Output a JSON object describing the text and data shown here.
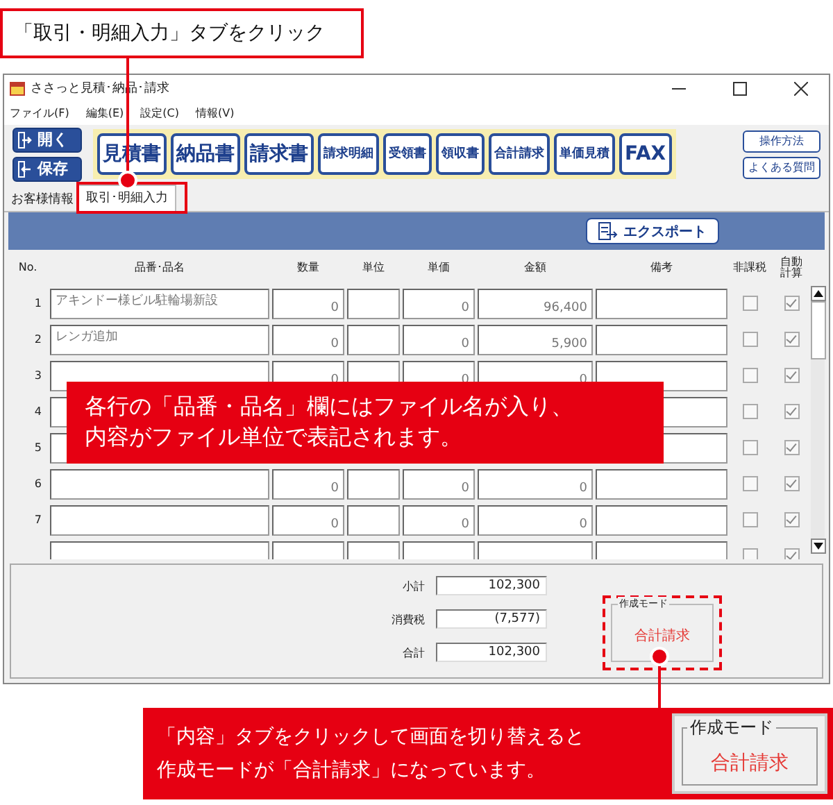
{
  "window": {
    "title": "ささっと見積･納品･請求"
  },
  "menu": [
    "ファイル(F)",
    "編集(E)",
    "設定(C)",
    "情報(V)"
  ],
  "file_buttons": [
    {
      "kind": "open",
      "label": "開く"
    },
    {
      "kind": "save",
      "label": "保存"
    }
  ],
  "document_buttons": [
    {
      "label": "見積書",
      "kind": "main"
    },
    {
      "label": "納品書",
      "kind": "main"
    },
    {
      "label": "請求書",
      "kind": "main"
    },
    {
      "label": "請求明細",
      "kind": "sub"
    },
    {
      "label": "受領書",
      "kind": "sub"
    },
    {
      "label": "領収書",
      "kind": "sub"
    },
    {
      "label": "合計請求",
      "kind": "sub"
    },
    {
      "label": "単価見積",
      "kind": "sub"
    },
    {
      "label": "FAX",
      "kind": "main"
    }
  ],
  "help_buttons": [
    "操作方法",
    "よくある質問"
  ],
  "tabs": [
    {
      "label": "お客様情報",
      "selected": false
    },
    {
      "label": "取引･明細入力",
      "selected": true
    }
  ],
  "export_button": "エクスポート",
  "table": {
    "columns": [
      "No.",
      "品番･品名",
      "数量",
      "単位",
      "単価",
      "金額",
      "備考",
      "非課税",
      "自動計算"
    ],
    "rows": [
      {
        "no": "1",
        "name": "アキンドー様ビル駐輪場新設",
        "quantity": "0",
        "unit_price": "0",
        "amount": "96,400",
        "tax_exempt": false,
        "auto_calc": true
      },
      {
        "no": "2",
        "name": "レンガ追加",
        "quantity": "0",
        "unit_price": "0",
        "amount": "5,900",
        "tax_exempt": false,
        "auto_calc": true
      },
      {
        "no": "3",
        "quantity": "0",
        "unit_price": "0",
        "amount": "0",
        "tax_exempt": false,
        "auto_calc": true
      },
      {
        "no": "4",
        "tax_exempt": false,
        "auto_calc": true
      },
      {
        "no": "5",
        "tax_exempt": false,
        "auto_calc": true
      },
      {
        "no": "6",
        "quantity": "0",
        "unit_price": "0",
        "amount": "0",
        "tax_exempt": false,
        "auto_calc": true
      },
      {
        "no": "7",
        "quantity": "0",
        "unit_price": "0",
        "amount": "0",
        "tax_exempt": false,
        "auto_calc": true
      },
      {
        "tax_exempt": false,
        "auto_calc": true
      }
    ]
  },
  "totals": [
    {
      "label": "小計",
      "value": "102,300"
    },
    {
      "label": "消費税",
      "value": "(7,577)"
    },
    {
      "label": "合計",
      "value": "102,300"
    }
  ],
  "mode_group": {
    "legend": "作成モード",
    "value": "合計請求"
  },
  "callouts": {
    "tab_hint": "「取引・明細入力」タブをクリック",
    "rows_note": "各行の「品番・品名」欄にはファイル名が入り、内容がファイル単位で表記されます。",
    "mode_note": "「内容」タブをクリックして画面を切り替えると作成モードが「合計請求」になっています。",
    "mode_legend": "作成モード",
    "mode_value": "合計請求"
  }
}
